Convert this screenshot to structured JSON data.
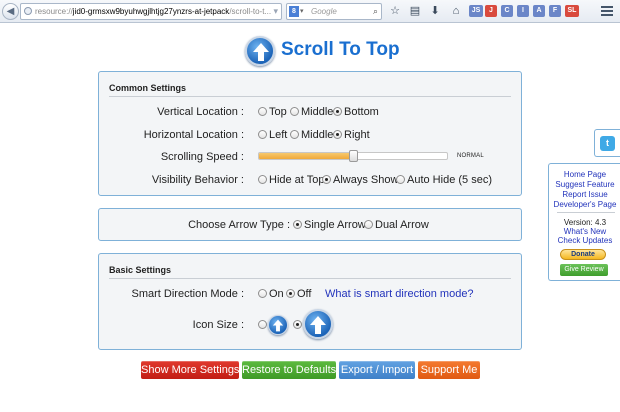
{
  "browser": {
    "url_prefix": "resource://",
    "url_host": "jid0-grmsxw9byuhwgjlhtjg27ynzrs-at-jetpack",
    "url_path": "/scroll-to-t...",
    "search_engine": "8",
    "search_placeholder": "Google",
    "extensions": [
      {
        "label": "JS",
        "color": "#6b86c8"
      },
      {
        "label": "J",
        "color": "#d94a3d"
      },
      {
        "label": "C",
        "color": "#6b86c8"
      },
      {
        "label": "I",
        "color": "#6b86c8"
      },
      {
        "label": "A",
        "color": "#6b86c8"
      },
      {
        "label": "F",
        "color": "#6b86c8"
      },
      {
        "label": "SL",
        "color": "#d94a3d"
      }
    ]
  },
  "header": {
    "title": "Scroll To Top"
  },
  "common_settings": {
    "title": "Common Settings",
    "vertical_location": {
      "label": "Vertical Location :",
      "options": [
        "Top",
        "Middle",
        "Bottom"
      ],
      "selected": "Bottom"
    },
    "horizontal_location": {
      "label": "Horizontal Location :",
      "options": [
        "Left",
        "Middle",
        "Right"
      ],
      "selected": "Right"
    },
    "scrolling_speed": {
      "label": "Scrolling Speed :",
      "value_label": "NORMAL",
      "fraction": 0.5
    },
    "visibility_behavior": {
      "label": "Visibility Behavior :",
      "options": [
        "Hide at Top",
        "Always Show",
        "Auto Hide (5 sec)"
      ],
      "selected": "Always Show"
    }
  },
  "arrow_type": {
    "label": "Choose Arrow Type :",
    "options": [
      "Single Arrow",
      "Dual Arrow"
    ],
    "selected": "Single Arrow"
  },
  "basic_settings": {
    "title": "Basic Settings",
    "smart_direction": {
      "label": "Smart Direction Mode :",
      "options": [
        "On",
        "Off"
      ],
      "selected": "Off",
      "help_link": "What is smart direction mode?"
    },
    "icon_size": {
      "label": "Icon Size :",
      "selected": "large"
    }
  },
  "actions": {
    "show_more": "Show More Settings",
    "restore": "Restore to Defaults",
    "export_import": "Export / Import",
    "support": "Support Me"
  },
  "side_panel": {
    "links": [
      "Home Page",
      "Suggest Feature",
      "Report Issue",
      "Developer's Page"
    ],
    "version": "Version: 4.3",
    "whats_new": "What's New",
    "check_updates": "Check Updates",
    "donate": "Donate",
    "give_review": "Give Review"
  },
  "colors": {
    "accent": "#1a6fd0",
    "panel_border": "#7fb1d8",
    "btn_red": "#d42a1f",
    "btn_green": "#4ea833",
    "btn_blue": "#4d8fd4",
    "btn_orange": "#ee6a1f"
  }
}
